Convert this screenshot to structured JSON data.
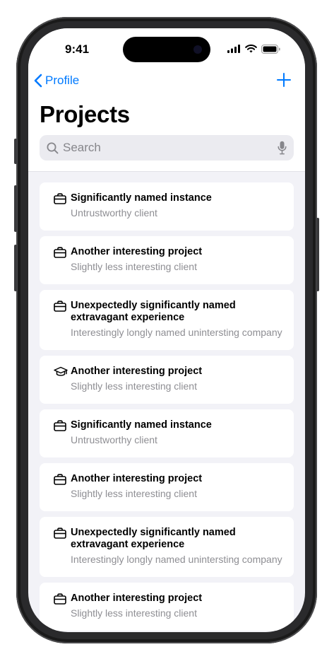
{
  "status_bar": {
    "time": "9:41"
  },
  "nav": {
    "back_label": "Profile"
  },
  "page": {
    "title": "Projects"
  },
  "search": {
    "placeholder": "Search"
  },
  "projects": [
    {
      "icon": "briefcase-icon",
      "title": "Significantly named instance",
      "client": "Untrustworthy client"
    },
    {
      "icon": "briefcase-icon",
      "title": "Another interesting project",
      "client": "Slightly less interesting client"
    },
    {
      "icon": "briefcase-icon",
      "title": "Unexpectedly significantly named extravagant experience",
      "client": "Interestingly longly named unintersting company"
    },
    {
      "icon": "graduation-cap-icon",
      "title": "Another interesting project",
      "client": "Slightly less interesting client"
    },
    {
      "icon": "briefcase-icon",
      "title": "Significantly named instance",
      "client": "Untrustworthy client"
    },
    {
      "icon": "briefcase-icon",
      "title": "Another interesting project",
      "client": "Slightly less interesting client"
    },
    {
      "icon": "briefcase-icon",
      "title": "Unexpectedly significantly named extravagant experience",
      "client": "Interestingly longly named unintersting company"
    },
    {
      "icon": "briefcase-icon",
      "title": "Another interesting project",
      "client": "Slightly less interesting client"
    }
  ],
  "colors": {
    "accent": "#007aff",
    "background": "#f2f2f7",
    "secondary_text": "#8e8e93"
  }
}
